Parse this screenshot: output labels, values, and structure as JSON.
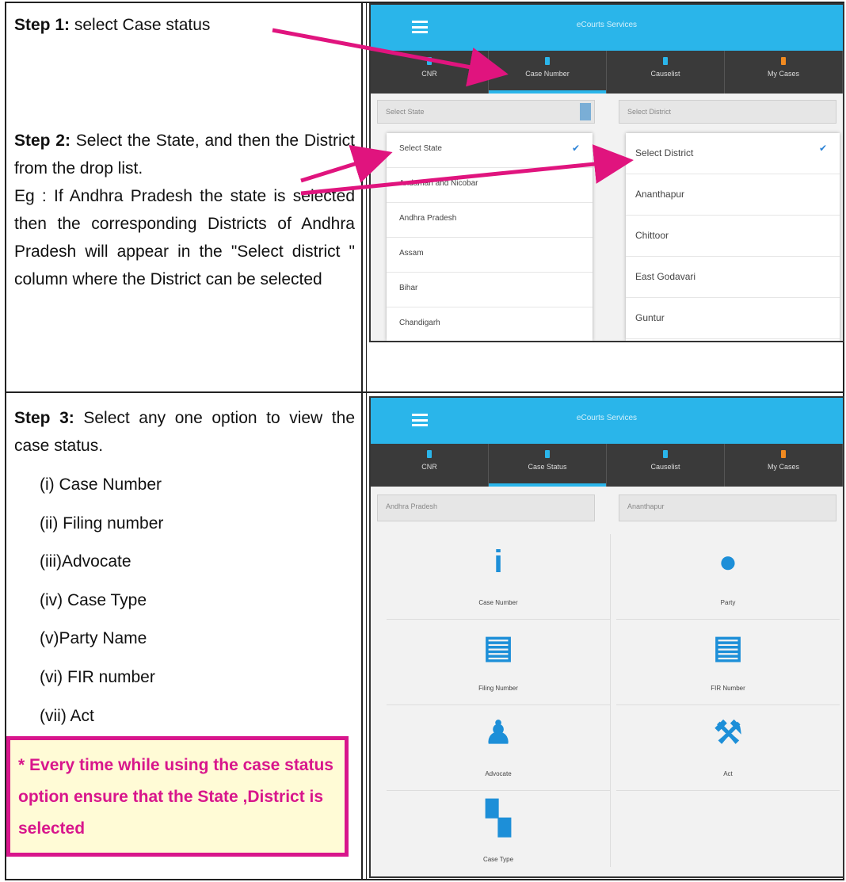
{
  "step1": {
    "label": "Step 1:",
    "text": " select Case status"
  },
  "step2": {
    "label": "Step 2:",
    "text": " Select the State, and then the District  from the drop list.",
    "example": "Eg : If Andhra Pradesh the state is selected then the corresponding Districts of Andhra Pradesh will appear in the \"Select district \" column where the District can be selected"
  },
  "step3": {
    "label": "Step 3:",
    "text": " Select any one option to view the case status.",
    "options": [
      "(i) Case Number",
      "(ii) Filing number",
      "(iii)Advocate",
      "(iv) Case Type",
      "(v)Party Name",
      "(vi) FIR number",
      "(vii) Act"
    ]
  },
  "note": "* Every time while using the case status option ensure that the State ,District is selected",
  "screen1": {
    "title": "eCourts Services",
    "tabs": [
      "CNR",
      "Case Number",
      "Causelist",
      "My Cases"
    ],
    "state_select": "Select State",
    "district_select": "Select District",
    "states": [
      "Select State",
      "Andaman and Nicobar",
      "Andhra Pradesh",
      "Assam",
      "Bihar",
      "Chandigarh"
    ],
    "districts": [
      "Select District",
      "Ananthapur",
      "Chittoor",
      "East Godavari",
      "Guntur"
    ]
  },
  "screen2": {
    "title": "eCourts Services",
    "tabs": [
      "CNR",
      "Case Status",
      "Causelist",
      "My Cases"
    ],
    "state_value": "Andhra Pradesh",
    "district_value": "Ananthapur",
    "options": [
      "Case Number",
      "Party",
      "Filing Number",
      "FIR Number",
      "Advocate",
      "Act",
      "Case Type"
    ]
  },
  "colors": {
    "accent": "#2ab5ea",
    "arrow": "#e0147e",
    "note": "#d8168c"
  }
}
